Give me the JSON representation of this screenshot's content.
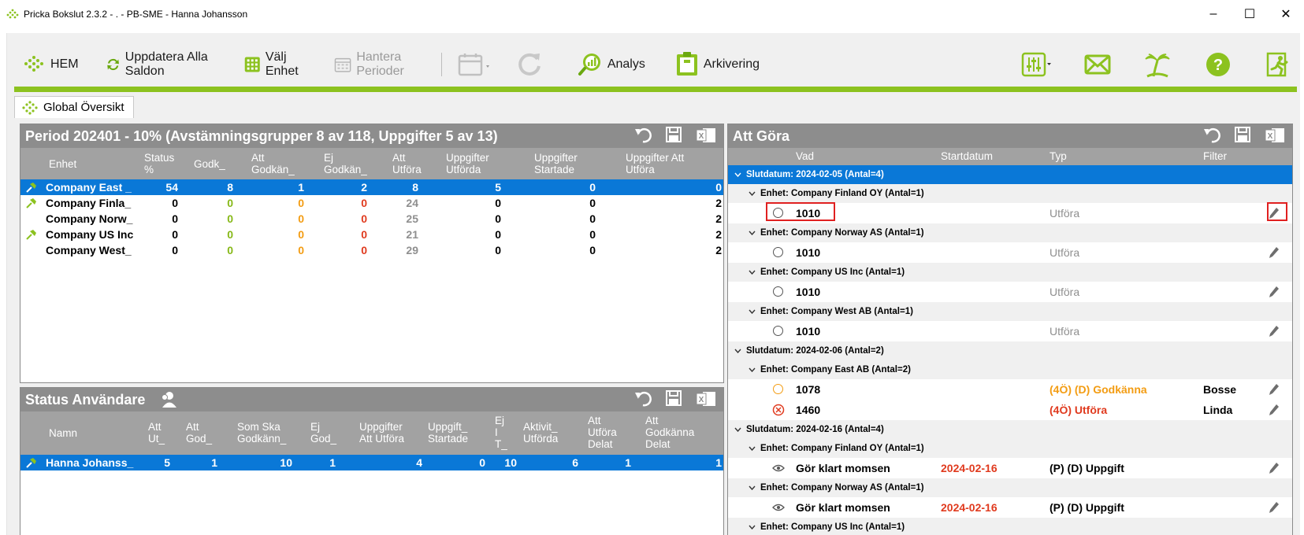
{
  "window": {
    "title": "Pricka Bokslut 2.3.2  - . - PB-SME - Hanna Johansson"
  },
  "toolbar": {
    "hem": "HEM",
    "uppdatera": "Uppdatera Alla Saldon",
    "valj_enhet": "Välj Enhet",
    "hantera_perioder": "Hantera Perioder",
    "analys": "Analys",
    "arkivering": "Arkivering"
  },
  "tab": {
    "label": "Global Översikt"
  },
  "period_panel": {
    "title": "Period 202401 - 10% (Avstämningsgrupper 8 av 118, Uppgifter 5 av 13)",
    "columns": [
      "Enhet",
      "Status %",
      "Godk_",
      "Att Godkän_",
      "Ej Godkän_",
      "Att Utföra",
      "Uppgifter Utförda",
      "Uppgifter Startade",
      "Uppgifter Att Utföra"
    ],
    "rows": [
      {
        "enhet": "Company East _",
        "status": "54",
        "godk": "8",
        "att_godk": "1",
        "ej_godk": "2",
        "att_utfora": "8",
        "utforda": "5",
        "startade": "0",
        "upp_att_utfora": "0"
      },
      {
        "enhet": "Company Finla_",
        "status": "0",
        "godk": "0",
        "att_godk": "0",
        "ej_godk": "0",
        "att_utfora": "24",
        "utforda": "0",
        "startade": "0",
        "upp_att_utfora": "2"
      },
      {
        "enhet": "Company Norw_",
        "status": "0",
        "godk": "0",
        "att_godk": "0",
        "ej_godk": "0",
        "att_utfora": "25",
        "utforda": "0",
        "startade": "0",
        "upp_att_utfora": "2"
      },
      {
        "enhet": "Company US Inc",
        "status": "0",
        "godk": "0",
        "att_godk": "0",
        "ej_godk": "0",
        "att_utfora": "21",
        "utforda": "0",
        "startade": "0",
        "upp_att_utfora": "2"
      },
      {
        "enhet": "Company West_",
        "status": "0",
        "godk": "0",
        "att_godk": "0",
        "ej_godk": "0",
        "att_utfora": "29",
        "utforda": "0",
        "startade": "0",
        "upp_att_utfora": "2"
      }
    ]
  },
  "status_panel": {
    "title": "Status Användare",
    "columns": [
      "Namn",
      "Att Ut_",
      "Att God_",
      "Som Ska Godkänn_",
      "Ej God_",
      "Uppgifter Att Utföra",
      "Uppgift_ Startade",
      "Ej I T_",
      "Aktivit_ Utförda",
      "Att Utföra Delat",
      "Att Godkänna Delat"
    ],
    "rows": [
      {
        "namn": "Hanna Johanss_",
        "v1": "5",
        "v2": "1",
        "v3": "10",
        "v4": "1",
        "v5": "4",
        "v6": "0",
        "v7": "10",
        "v8": "6",
        "v9": "1",
        "v10": "1"
      }
    ]
  },
  "todo_panel": {
    "title": "Att Göra",
    "columns": [
      "Vad",
      "Startdatum",
      "Typ",
      "Filter"
    ],
    "groups": [
      "Slutdatum: 2024-02-05 (Antal=4)",
      "Enhet: Company Finland OY (Antal=1)",
      "Enhet: Company Norway AS (Antal=1)",
      "Enhet: Company US Inc (Antal=1)",
      "Enhet: Company West AB (Antal=1)",
      "Slutdatum: 2024-02-06 (Antal=2)",
      "Enhet: Company East AB (Antal=2)",
      "Slutdatum: 2024-02-16 (Antal=4)",
      "Enhet: Company Finland OY (Antal=1)",
      "Enhet: Company Norway AS (Antal=1)",
      "Enhet: Company US Inc (Antal=1)"
    ],
    "items": [
      {
        "vad": "1010",
        "start": "",
        "typ": "Utföra",
        "filter": ""
      },
      {
        "vad": "1010",
        "start": "",
        "typ": "Utföra",
        "filter": ""
      },
      {
        "vad": "1010",
        "start": "",
        "typ": "Utföra",
        "filter": ""
      },
      {
        "vad": "1010",
        "start": "",
        "typ": "Utföra",
        "filter": ""
      },
      {
        "vad": "1078",
        "start": "",
        "typ": "(4Ö) (D) Godkänna",
        "filter": "Bosse"
      },
      {
        "vad": "1460",
        "start": "",
        "typ": "(4Ö) Utföra",
        "filter": "Linda"
      },
      {
        "vad": "Gör klart momsen",
        "start": "2024-02-16",
        "typ": "(P) (D) Uppgift",
        "filter": ""
      },
      {
        "vad": "Gör klart momsen",
        "start": "2024-02-16",
        "typ": "(P) (D) Uppgift",
        "filter": ""
      }
    ]
  },
  "colors": {
    "accent_green": "#8cc21f",
    "selection_blue": "#0a78d7",
    "header_grey": "#8d8d8d"
  }
}
